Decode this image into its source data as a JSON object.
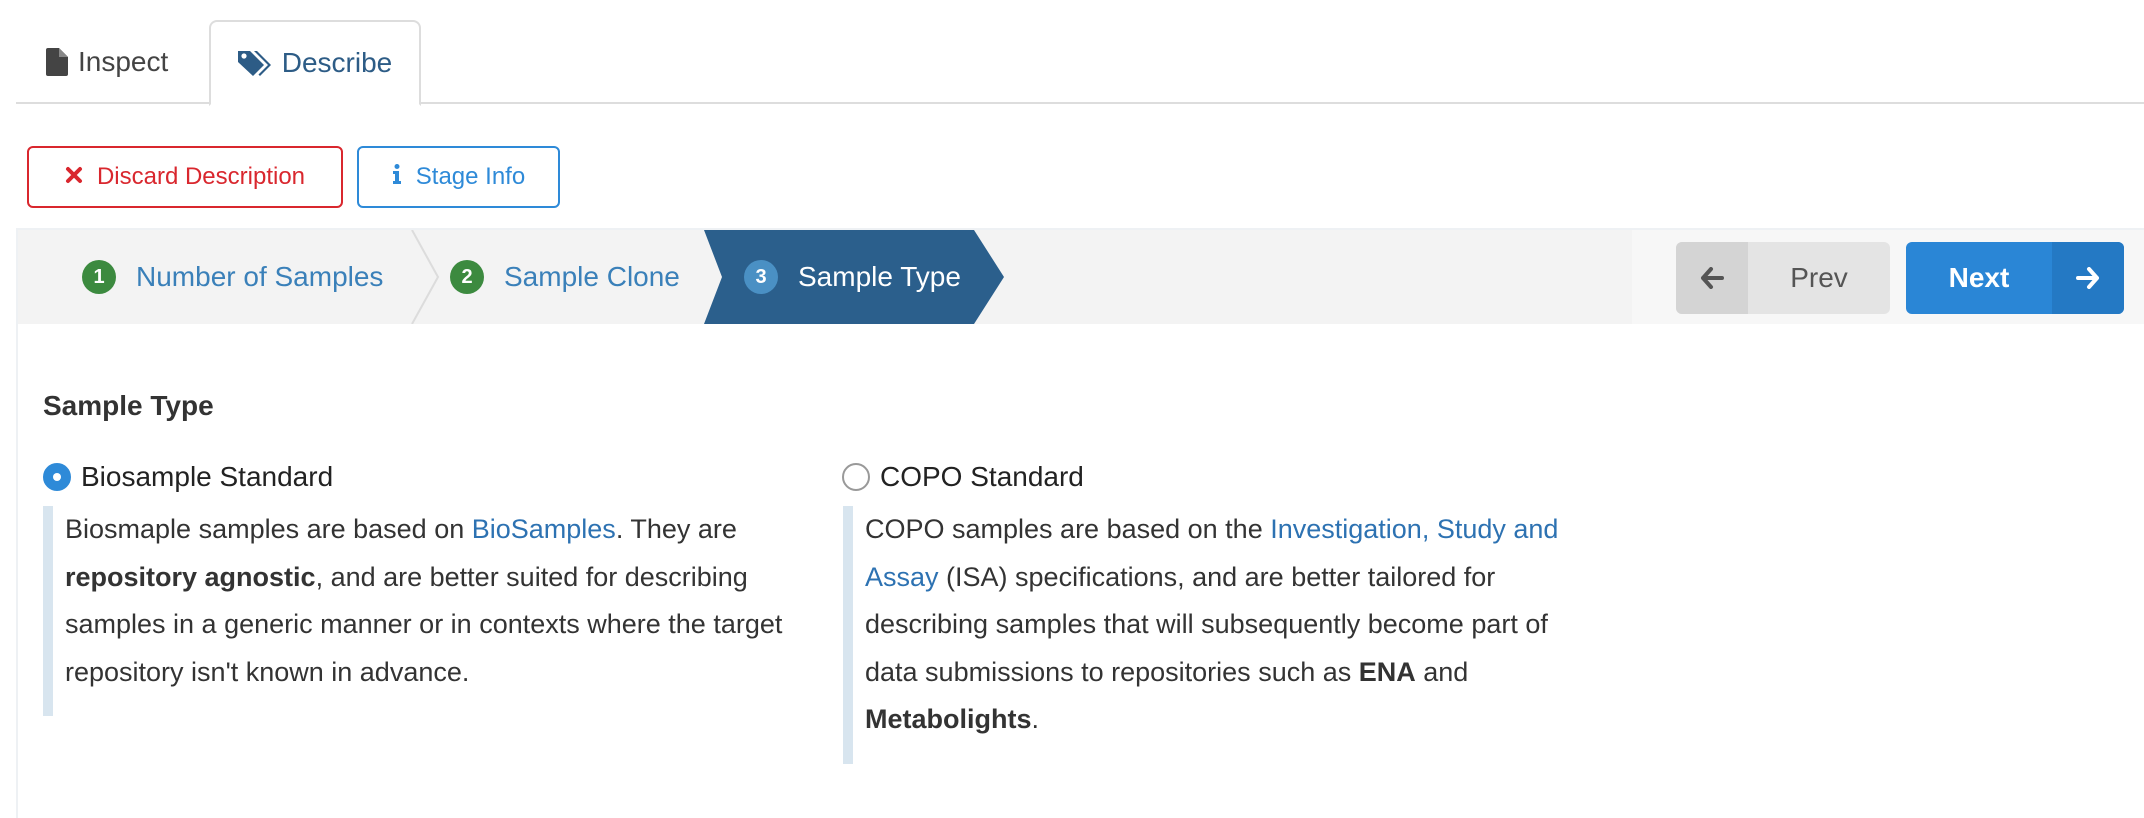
{
  "tabs": [
    {
      "label": "Inspect",
      "icon": "file-icon"
    },
    {
      "label": "Describe",
      "icon": "tags-icon",
      "active": true
    }
  ],
  "actions": {
    "discard_label": "Discard Description",
    "stage_info_label": "Stage Info"
  },
  "wizard": {
    "steps": [
      {
        "number": "1",
        "label": "Number of Samples"
      },
      {
        "number": "2",
        "label": "Sample Clone"
      },
      {
        "number": "3",
        "label": "Sample Type",
        "active": true
      }
    ],
    "prev_label": "Prev",
    "next_label": "Next"
  },
  "content": {
    "title": "Sample Type",
    "options": [
      {
        "label": "Biosample Standard",
        "selected": true,
        "desc": {
          "pre": "Biosmaple samples are based on ",
          "link": "BioSamples",
          "mid": ". They are ",
          "bold": "repository agnostic",
          "post": ", and are better suited for describing samples in a generic manner or in contexts where the target repository isn't known in advance."
        }
      },
      {
        "label": "COPO Standard",
        "selected": false,
        "desc": {
          "pre": "COPO samples are based on the ",
          "link": "Investigation, Study and Assay",
          "mid": " (ISA) specifications, and are better tailored for describing samples that will subsequently become part of data submissions to repositories such as ",
          "bold1": "ENA",
          "and": " and ",
          "bold2": "Metabolights",
          "end": "."
        }
      }
    ]
  },
  "colors": {
    "accent": "#2e8ad8",
    "danger": "#d9272e",
    "active_step": "#2b5f8c",
    "step_badge": "#3c8a3f"
  }
}
